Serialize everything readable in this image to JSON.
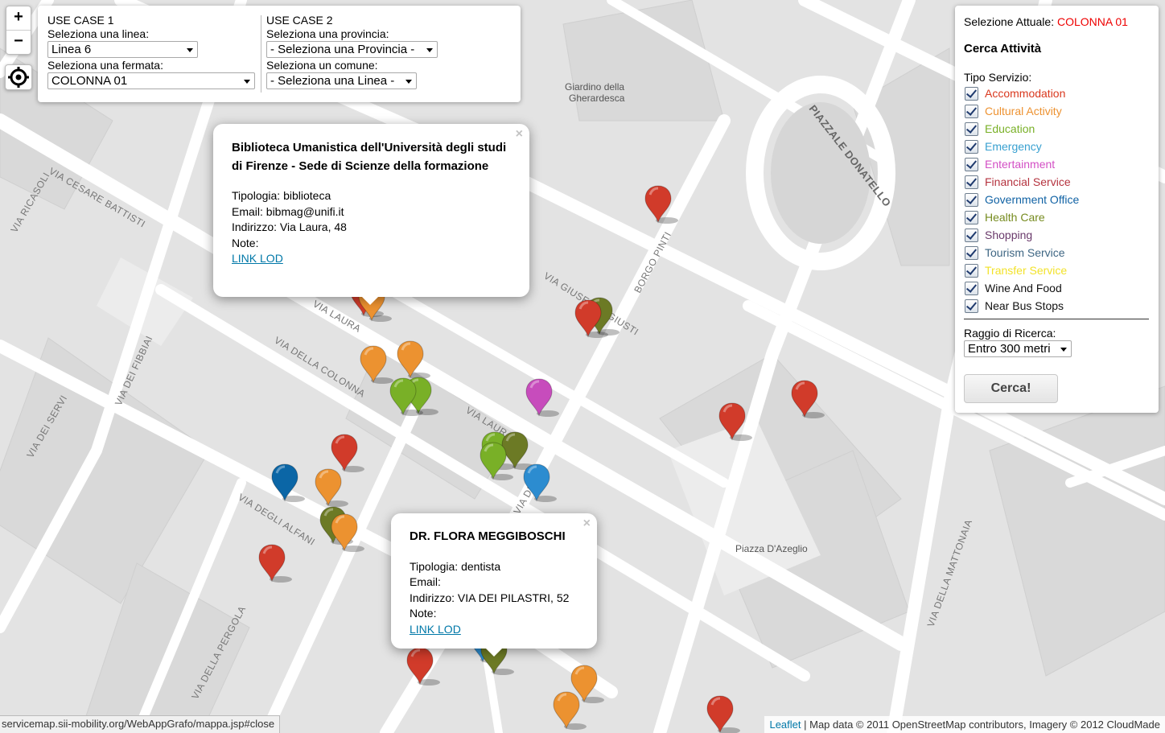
{
  "map": {
    "zoom_in": "+",
    "zoom_out": "−",
    "streets": [
      "VIA RICASOLI",
      "VIA CESARE BATTISTI",
      "VIA LAURA",
      "VIA DELLA COLONNA",
      "VIA DEI FIBBIAI",
      "VIA DEI SERVI",
      "VIA DEGLI ALFANI",
      "VIA DELLA PERGOLA",
      "BORGO PINTI",
      "VIA GIUSEPPE GIUSTI",
      "PIAZZALE DONATELLO",
      "VIA DELLA MATTONAIA",
      "VIA DI",
      "VIA LAURA"
    ],
    "places": {
      "giardino_1": "Giardino della",
      "giardino_2": "Gherardesca",
      "azeglio": "Piazza D'Azeglio"
    },
    "marker_colors": {
      "accommodation": "#d13b2a",
      "cultural": "#ec9230",
      "education": "#79b027",
      "emergency": "#2c8cd0",
      "entertainment": "#c74cbc",
      "government": "#0b66a6",
      "health": "#6c7a25"
    }
  },
  "use_case_1": {
    "title": "USE CASE 1",
    "line_label": "Seleziona una linea:",
    "line_value": "Linea 6",
    "stop_label": "Seleziona una fermata:",
    "stop_value": "COLONNA 01"
  },
  "use_case_2": {
    "title": "USE CASE 2",
    "province_label": "Seleziona una provincia:",
    "province_value": "- Seleziona una Provincia -",
    "comune_label": "Seleziona un comune:",
    "comune_value": "- Seleziona una Linea -"
  },
  "search_panel": {
    "selection_label": "Selezione Attuale:",
    "selection_value": "COLONNA 01",
    "title": "Cerca Attività",
    "tipo_label": "Tipo Servizio:",
    "services": [
      {
        "label": "Accommodation",
        "color": "#d9381e"
      },
      {
        "label": "Cultural Activity",
        "color": "#ed9231"
      },
      {
        "label": "Education",
        "color": "#79b027"
      },
      {
        "label": "Emergency",
        "color": "#38a0d0"
      },
      {
        "label": "Entertainment",
        "color": "#d34fc5"
      },
      {
        "label": "Financial Service",
        "color": "#b5333f"
      },
      {
        "label": "Government Office",
        "color": "#1062a4"
      },
      {
        "label": "Health Care",
        "color": "#768b1f"
      },
      {
        "label": "Shopping",
        "color": "#6a3a6b"
      },
      {
        "label": "Tourism Service",
        "color": "#3e6683"
      },
      {
        "label": "Transfer Service",
        "color": "#f2e22a"
      },
      {
        "label": "Wine And Food",
        "color": "#111111"
      },
      {
        "label": "Near Bus Stops",
        "color": "#111111"
      }
    ],
    "radius_label": "Raggio di Ricerca:",
    "radius_value": "Entro 300 metri",
    "search_button": "Cerca!"
  },
  "popup1": {
    "close": "×",
    "title": "Biblioteca Umanistica dell'Università degli studi di Firenze - Sede di Scienze della formazione",
    "tipologia": "Tipologia: biblioteca",
    "email": "Email: bibmag@unifi.it",
    "indirizzo": "Indirizzo: Via Laura, 48",
    "note": "Note:",
    "link": "LINK LOD"
  },
  "popup2": {
    "close": "×",
    "title": "DR. FLORA MEGGIBOSCHI",
    "tipologia": "Tipologia: dentista",
    "email": "Email:",
    "indirizzo": "Indirizzo: VIA DEI PILASTRI, 52",
    "note": "Note:",
    "link": "LINK LOD"
  },
  "status_bar": "servicemap.sii-mobility.org/WebAppGrafo/mappa.jsp#close",
  "attribution": {
    "leaflet": "Leaflet",
    "text": " | Map data © 2011 OpenStreetMap contributors, Imagery © 2012 CloudMade"
  }
}
